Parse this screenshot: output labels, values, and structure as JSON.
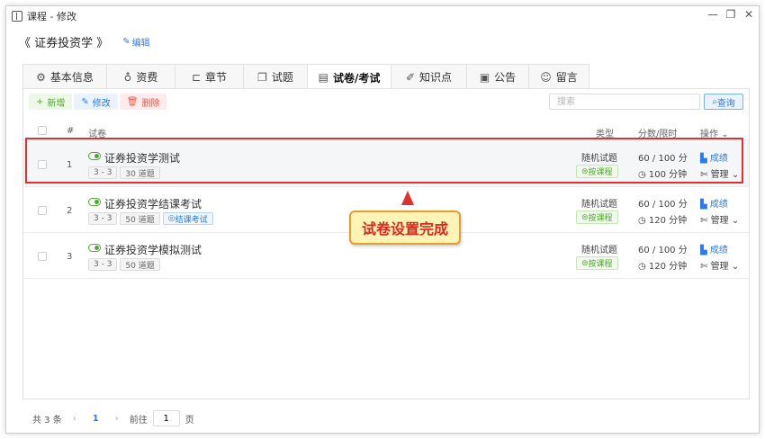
{
  "window": {
    "title": "课程 - 修改",
    "controls": {
      "minimize": "—",
      "restore": "❐",
      "close": "✕"
    }
  },
  "course": {
    "title": "《 证券投资学 》",
    "edit_label": "编辑"
  },
  "tabs": [
    {
      "label": "基本信息",
      "icon": "gear-icon"
    },
    {
      "label": "资费",
      "icon": "money-bag-icon"
    },
    {
      "label": "章节",
      "icon": "chapter-icon"
    },
    {
      "label": "试题",
      "icon": "question-icon"
    },
    {
      "label": "试卷/考试",
      "icon": "exam-paper-icon",
      "active": true
    },
    {
      "label": "知识点",
      "icon": "knowledge-icon"
    },
    {
      "label": "公告",
      "icon": "notice-icon"
    },
    {
      "label": "留言",
      "icon": "message-icon"
    }
  ],
  "toolbar": {
    "new_label": "新增",
    "edit_label": "修改",
    "delete_label": "删除",
    "search_placeholder": "搜索",
    "search_button": "查询"
  },
  "table": {
    "headers": {
      "num": "#",
      "paper": "试卷",
      "type": "类型",
      "score": "分数/限时",
      "ops": "操作"
    },
    "rows": [
      {
        "num": "1",
        "title": "证券投资学测试",
        "tags": [
          "3 - 3",
          "30 道题"
        ],
        "extra_tag": "",
        "type": "随机试题",
        "type_tag": "按课程",
        "score": "60 / 100 分",
        "limit": "100 分钟",
        "result": "成绩",
        "manage": "管理"
      },
      {
        "num": "2",
        "title": "证券投资学结课考试",
        "tags": [
          "3 - 3",
          "50 道题"
        ],
        "extra_tag": "结课考试",
        "type": "随机试题",
        "type_tag": "按课程",
        "score": "60 / 100 分",
        "limit": "120 分钟",
        "result": "成绩",
        "manage": "管理"
      },
      {
        "num": "3",
        "title": "证券投资学模拟测试",
        "tags": [
          "3 - 3",
          "50 道题"
        ],
        "extra_tag": "",
        "type": "随机试题",
        "type_tag": "按课程",
        "score": "60 / 100 分",
        "limit": "120 分钟",
        "result": "成绩",
        "manage": "管理"
      }
    ]
  },
  "callout": {
    "text": "试卷设置完成"
  },
  "pagination": {
    "total": "共 3 条",
    "prev": "‹",
    "current": "1",
    "next": "›",
    "goto_label": "前往",
    "goto_value": "1",
    "page_suffix": "页"
  },
  "colors": {
    "accent": "#2d7be5",
    "success": "#52a831",
    "danger": "#e55b4d",
    "highlight_border": "#e03131",
    "callout_bg": "#fff4b5"
  }
}
